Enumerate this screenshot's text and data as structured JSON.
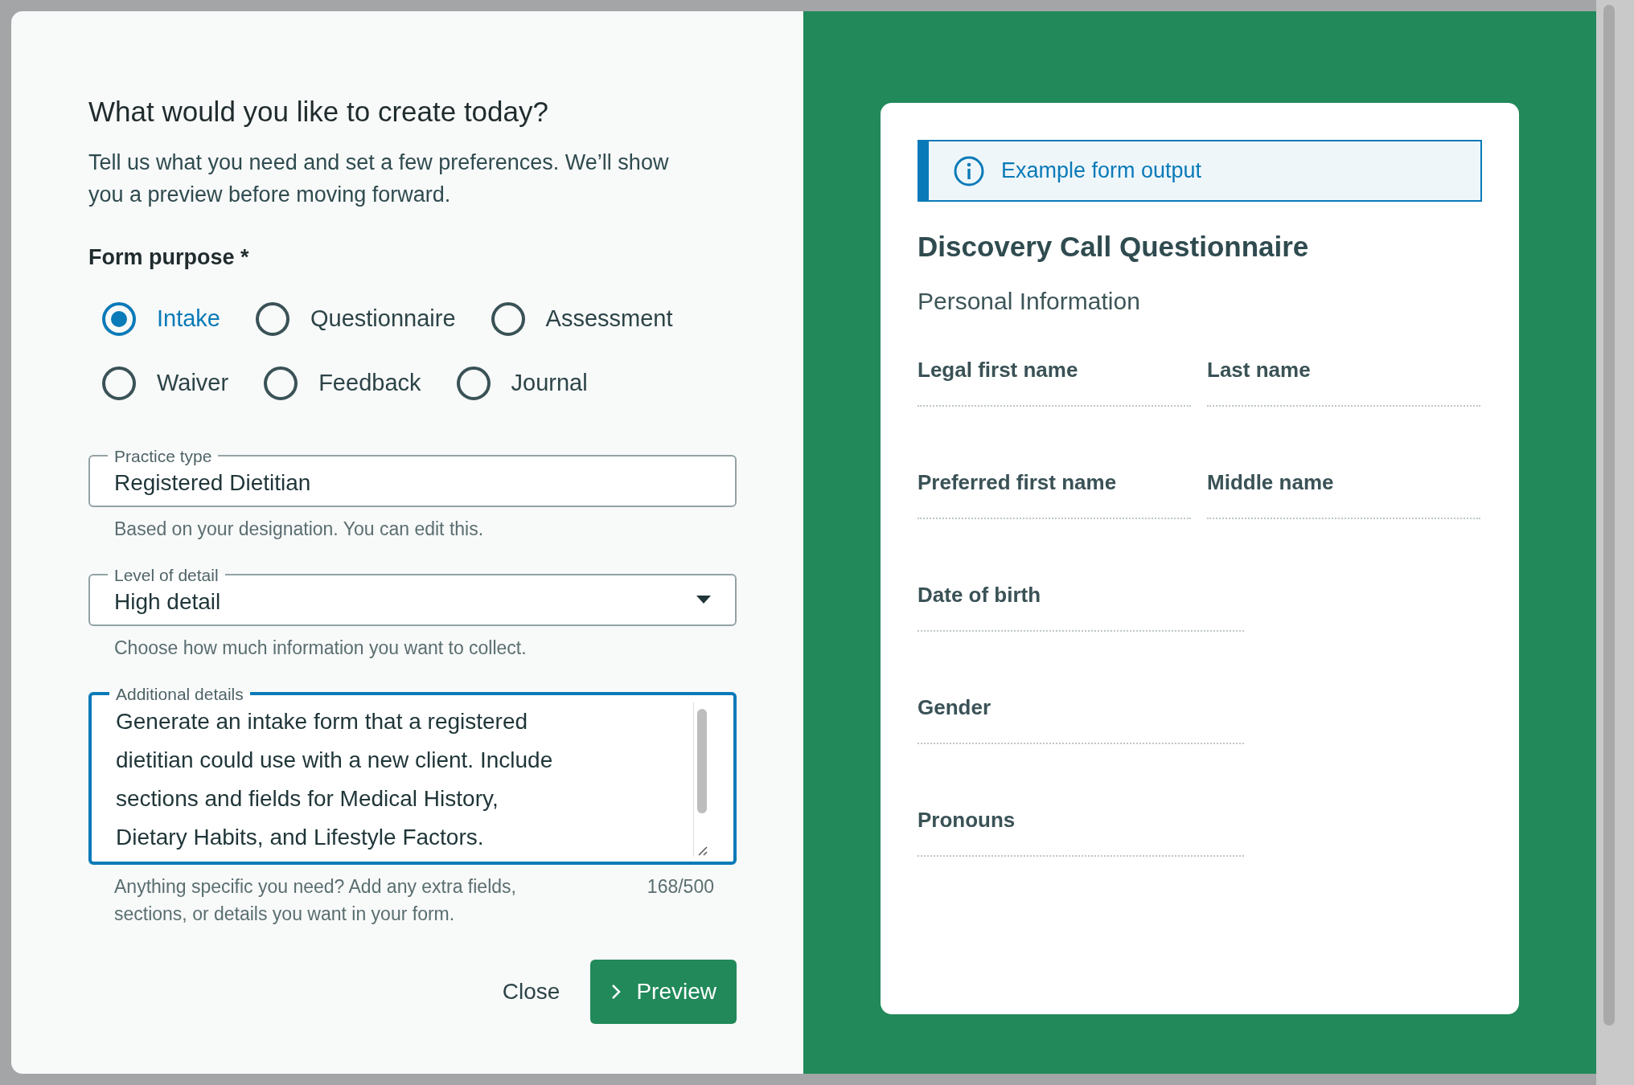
{
  "dialog": {
    "heading": "What would you like to create today?",
    "intro": "Tell us what you need and set a few preferences. We’ll show you a preview before moving forward.",
    "purpose": {
      "label": "Form purpose *",
      "options": [
        {
          "label": "Intake",
          "selected": true
        },
        {
          "label": "Questionnaire",
          "selected": false
        },
        {
          "label": "Assessment",
          "selected": false
        },
        {
          "label": "Waiver",
          "selected": false
        },
        {
          "label": "Feedback",
          "selected": false
        },
        {
          "label": "Journal",
          "selected": false
        }
      ]
    },
    "practice_type": {
      "label": "Practice type",
      "value": "Registered Dietitian",
      "help": "Based on your designation. You can edit this."
    },
    "detail_level": {
      "label": "Level of detail",
      "value": "High detail",
      "help": "Choose how much information you want to collect."
    },
    "additional_details": {
      "label": "Additional details",
      "value": "Generate an intake form that a registered dietitian could use with a new client. Include sections and fields for Medical History, Dietary Habits, and Lifestyle Factors.",
      "focused": true,
      "help": "Anything specific you need? Add any extra fields, sections, or details you want in your form.",
      "counter": "168/500"
    },
    "buttons": [
      {
        "label": "Close",
        "kind": "text"
      },
      {
        "label": "Preview",
        "kind": "primary"
      }
    ]
  },
  "preview": {
    "banner": "Example form output",
    "title": "Discovery Call Questionnaire",
    "section": "Personal Information",
    "rows": [
      {
        "fields": [
          "Legal first name",
          "Last name"
        ]
      },
      {
        "fields": [
          "Preferred first name",
          "Middle name"
        ]
      },
      {
        "fields": [
          "Date of birth"
        ]
      },
      {
        "fields": [
          "Gender"
        ]
      },
      {
        "fields": [
          "Pronouns"
        ]
      }
    ]
  }
}
